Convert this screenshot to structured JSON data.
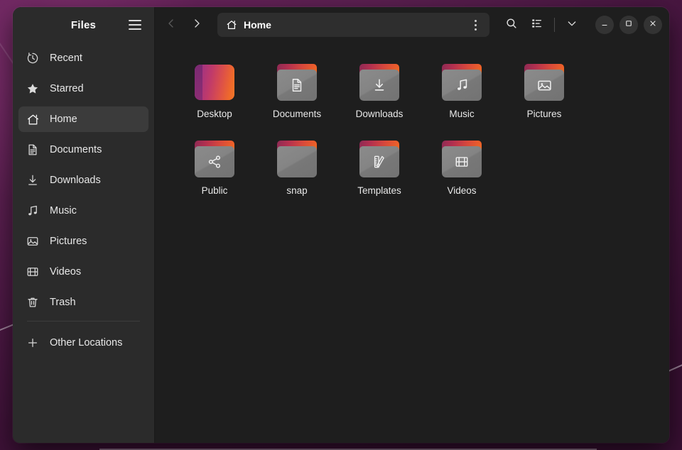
{
  "window": {
    "app_title": "Files",
    "menu_icon": "hamburger-icon"
  },
  "sidebar": {
    "items": [
      {
        "label": "Recent",
        "icon": "clock-icon",
        "active": false
      },
      {
        "label": "Starred",
        "icon": "star-icon",
        "active": false
      },
      {
        "label": "Home",
        "icon": "home-icon",
        "active": true
      },
      {
        "label": "Documents",
        "icon": "document-icon",
        "active": false
      },
      {
        "label": "Downloads",
        "icon": "download-icon",
        "active": false
      },
      {
        "label": "Music",
        "icon": "music-note-icon",
        "active": false
      },
      {
        "label": "Pictures",
        "icon": "image-icon",
        "active": false
      },
      {
        "label": "Videos",
        "icon": "film-icon",
        "active": false
      },
      {
        "label": "Trash",
        "icon": "trash-icon",
        "active": false
      }
    ],
    "other_locations": {
      "label": "Other Locations",
      "icon": "plus-icon"
    }
  },
  "headerbar": {
    "back_icon": "chevron-left-icon",
    "forward_icon": "chevron-right-icon",
    "breadcrumb": "Home",
    "breadcrumb_icon": "home-icon",
    "path_menu_icon": "kebab-menu-icon",
    "search_icon": "search-icon",
    "view_icon": "list-view-icon",
    "view_dropdown_icon": "chevron-down-icon",
    "minimize_icon": "minimize-icon",
    "maximize_icon": "maximize-icon",
    "close_icon": "close-icon"
  },
  "files": [
    {
      "name": "Desktop",
      "type": "special-folder",
      "glyph": "gradient-square"
    },
    {
      "name": "Documents",
      "type": "folder",
      "glyph": "document-icon"
    },
    {
      "name": "Downloads",
      "type": "folder",
      "glyph": "download-icon"
    },
    {
      "name": "Music",
      "type": "folder",
      "glyph": "music-note-icon"
    },
    {
      "name": "Pictures",
      "type": "folder",
      "glyph": "image-icon"
    },
    {
      "name": "Public",
      "type": "folder",
      "glyph": "share-icon"
    },
    {
      "name": "snap",
      "type": "folder",
      "glyph": "none"
    },
    {
      "name": "Templates",
      "type": "folder",
      "glyph": "ruler-pencil-icon"
    },
    {
      "name": "Videos",
      "type": "folder",
      "glyph": "film-icon"
    }
  ],
  "colors": {
    "window_bg": "#1e1e1e",
    "sidebar_bg": "#2b2b2b",
    "sidebar_active": "#3b3b3b",
    "pathbar_bg": "#2e2e2e",
    "text": "#e8e8e8",
    "wallpaper": "#5d2052",
    "folder_accent_start": "#8e2a54",
    "folder_accent_end": "#f06426"
  }
}
